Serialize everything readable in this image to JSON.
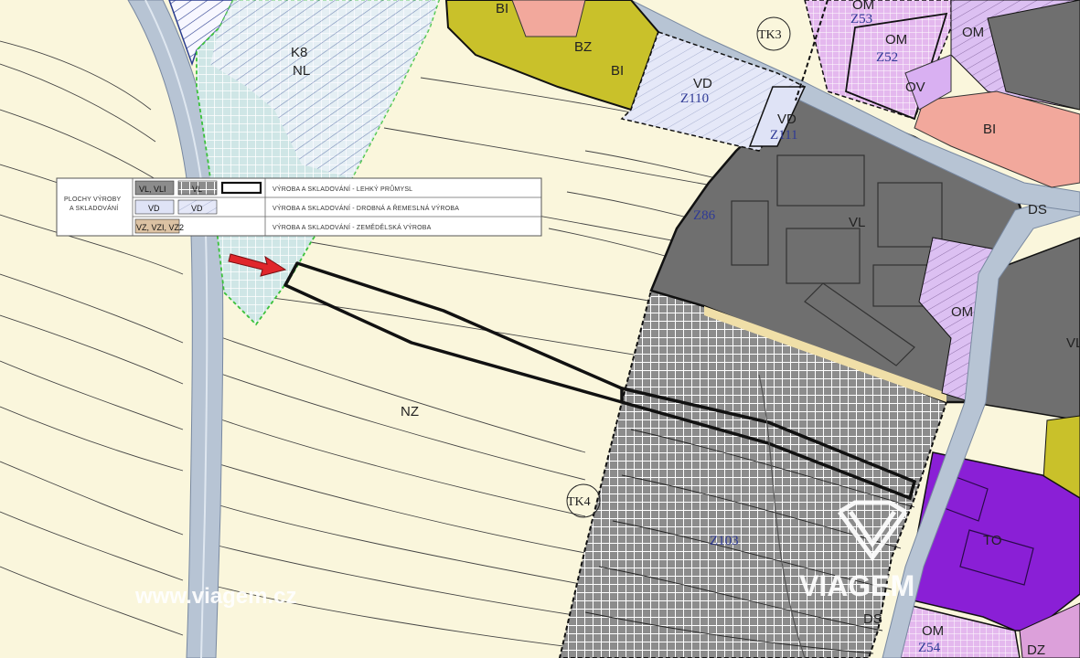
{
  "map": {
    "zones": [
      {
        "code": "BI",
        "id": "bi-top"
      },
      {
        "code": "BZ",
        "id": "bz-top"
      },
      {
        "code": "BI",
        "id": "bi-top-right"
      },
      {
        "code": "K8",
        "id": "k8"
      },
      {
        "code": "NL",
        "id": "nl"
      },
      {
        "code": "VD",
        "id": "vd-z110"
      },
      {
        "code": "Z110",
        "id": "z110"
      },
      {
        "code": "VD",
        "id": "vd-z111"
      },
      {
        "code": "Z111",
        "id": "z111"
      },
      {
        "code": "TK3",
        "id": "tk3"
      },
      {
        "code": "Z53",
        "id": "z53"
      },
      {
        "code": "OM",
        "id": "om-z53"
      },
      {
        "code": "OM",
        "id": "om-z52"
      },
      {
        "code": "Z52",
        "id": "z52"
      },
      {
        "code": "OM",
        "id": "om-top-right"
      },
      {
        "code": "OV",
        "id": "ov"
      },
      {
        "code": "BI",
        "id": "bi-right"
      },
      {
        "code": "DS",
        "id": "ds-right"
      },
      {
        "code": "Z86",
        "id": "z86"
      },
      {
        "code": "VL",
        "id": "vl-main"
      },
      {
        "code": "OM",
        "id": "om-mid"
      },
      {
        "code": "VL",
        "id": "vl-right"
      },
      {
        "code": "NZ",
        "id": "nz"
      },
      {
        "code": "TK4",
        "id": "tk4"
      },
      {
        "code": "Z103",
        "id": "z103"
      },
      {
        "code": "TO",
        "id": "to"
      },
      {
        "code": "DS",
        "id": "ds-bottom"
      },
      {
        "code": "OM",
        "id": "om-bottom"
      },
      {
        "code": "Z54",
        "id": "z54"
      },
      {
        "code": "DZ",
        "id": "dz"
      }
    ]
  },
  "legend": {
    "category": [
      "PLOCHY VÝROBY",
      "A SKLADOVÁNÍ"
    ],
    "codes": {
      "light": "VL, VLI",
      "light_hatch": "VL",
      "craft": "VD",
      "craft_hatch": "VD",
      "agri": "VZ, VZI, VZ2"
    },
    "descriptions": [
      "VÝROBA A SKLADOVÁNÍ - LEHKÝ PRŮMYSL",
      "VÝROBA A SKLADOVÁNÍ - DROBNÁ A ŘEMESLNÁ VÝROBA",
      "VÝROBA A SKLADOVÁNÍ - ZEMĚDĚLSKÁ VÝROBA"
    ]
  },
  "watermark": {
    "url": "www.viagem.cz",
    "brand": "VIAGEM"
  },
  "colors": {
    "background": "#faf6dc",
    "light_industry": "#6f6f6f",
    "craft": "#dfe3f6",
    "forest_hatch": "#bfdede",
    "residential_yellow": "#c9c12a",
    "civic_pink": "#f2a89c",
    "civic_purple": "#d9b0f2",
    "technical_purple": "#8a1fd6",
    "road": "#b7c4d4",
    "accent_arrow": "#e0262b"
  }
}
